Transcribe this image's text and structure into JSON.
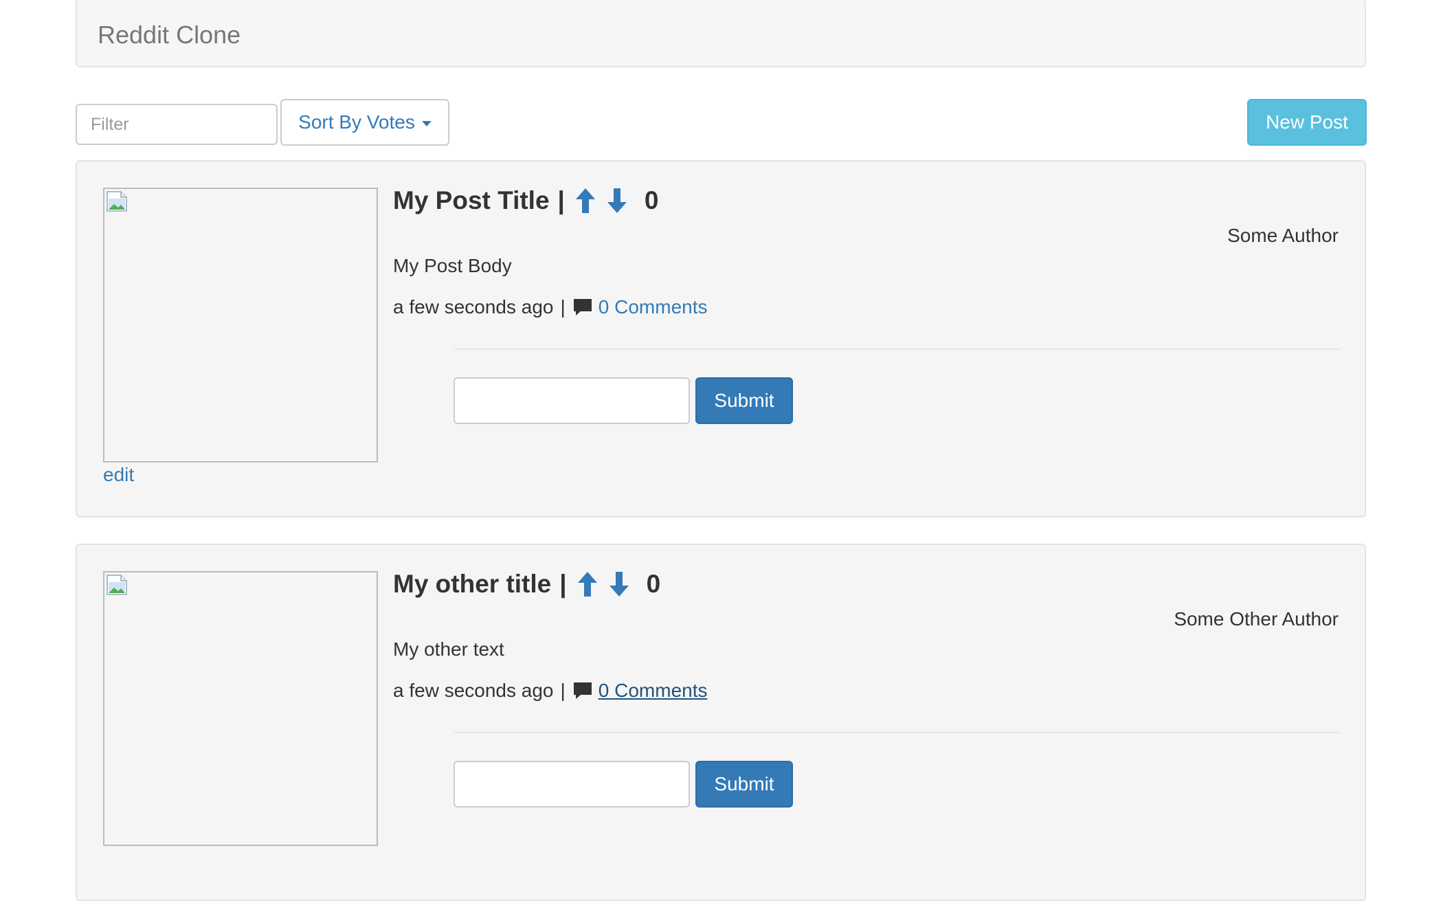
{
  "app": {
    "title": "Reddit Clone"
  },
  "toolbar": {
    "filter_placeholder": "Filter",
    "sort_label": "Sort By Votes",
    "new_post_label": "New Post"
  },
  "colors": {
    "link": "#337ab7",
    "primary_button": "#337ab7",
    "info_button": "#5bc0de",
    "panel_bg": "#f5f5f5"
  },
  "posts": [
    {
      "title": "My Post Title",
      "separator": "|",
      "score": "0",
      "author": "Some Author",
      "body": "My Post Body",
      "timestamp": "a few seconds ago",
      "meta_separator": "|",
      "comments_label": "0 Comments",
      "edit_label": "edit",
      "submit_label": "Submit",
      "icons": {
        "up": "arrow-up-icon",
        "down": "arrow-down-icon",
        "comment": "comment-icon",
        "image": "broken-image-icon"
      }
    },
    {
      "title": "My other title",
      "separator": "|",
      "score": "0",
      "author": "Some Other Author",
      "body": "My other text",
      "timestamp": "a few seconds ago",
      "meta_separator": "|",
      "comments_label": "0 Comments",
      "submit_label": "Submit",
      "icons": {
        "up": "arrow-up-icon",
        "down": "arrow-down-icon",
        "comment": "comment-icon",
        "image": "broken-image-icon"
      }
    }
  ]
}
